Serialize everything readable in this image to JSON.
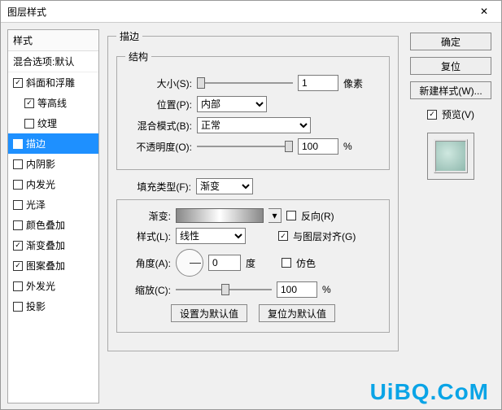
{
  "window": {
    "title": "图层样式"
  },
  "sidebar": {
    "header": "样式",
    "blend": "混合选项:默认",
    "items": [
      {
        "label": "斜面和浮雕",
        "checked": true
      },
      {
        "label": "等高线",
        "checked": true,
        "sub": true
      },
      {
        "label": "纹理",
        "checked": false,
        "sub": true
      },
      {
        "label": "描边",
        "checked": true,
        "selected": true
      },
      {
        "label": "内阴影",
        "checked": false
      },
      {
        "label": "内发光",
        "checked": false
      },
      {
        "label": "光泽",
        "checked": false
      },
      {
        "label": "颜色叠加",
        "checked": false
      },
      {
        "label": "渐变叠加",
        "checked": true
      },
      {
        "label": "图案叠加",
        "checked": true
      },
      {
        "label": "外发光",
        "checked": false
      },
      {
        "label": "投影",
        "checked": false
      }
    ]
  },
  "panel": {
    "title": "描边",
    "structure": {
      "legend": "结构",
      "size_label": "大小(S):",
      "size_value": "1",
      "size_unit": "像素",
      "position_label": "位置(P):",
      "position_value": "内部",
      "blendmode_label": "混合模式(B):",
      "blendmode_value": "正常",
      "opacity_label": "不透明度(O):",
      "opacity_value": "100",
      "opacity_unit": "%"
    },
    "fill": {
      "filltype_label": "填充类型(F):",
      "filltype_value": "渐变",
      "gradient_label": "渐变:",
      "reverse_label": "反向(R)",
      "reverse_checked": false,
      "style_label": "样式(L):",
      "style_value": "线性",
      "alignlayer_label": "与图层对齐(G)",
      "alignlayer_checked": true,
      "angle_label": "角度(A):",
      "angle_value": "0",
      "angle_unit": "度",
      "dither_label": "仿色",
      "dither_checked": false,
      "scale_label": "缩放(C):",
      "scale_value": "100",
      "scale_unit": "%",
      "set_default": "设置为默认值",
      "reset_default": "复位为默认值"
    }
  },
  "right": {
    "ok": "确定",
    "cancel": "复位",
    "newstyle": "新建样式(W)...",
    "preview_label": "预览(V)",
    "preview_checked": true
  },
  "watermark": "UiBQ.CoM"
}
